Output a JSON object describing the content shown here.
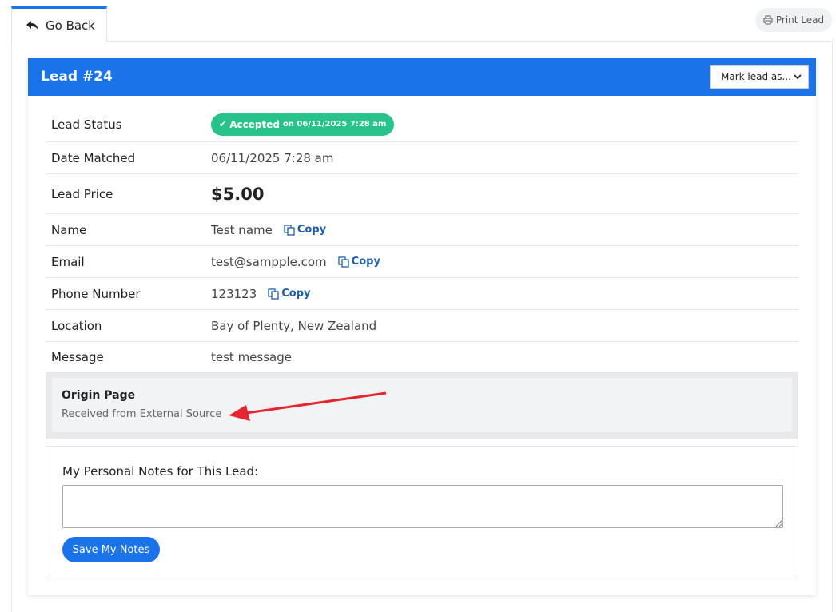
{
  "nav": {
    "go_back_label": "Go Back",
    "print_label": "Print Lead"
  },
  "card": {
    "title": "Lead #24",
    "mark_select_label": "Mark lead as..."
  },
  "details": {
    "status": {
      "label": "Lead Status",
      "badge_text": "Accepted",
      "badge_date": "on 06/11/2025 7:28 am"
    },
    "date_matched": {
      "label": "Date Matched",
      "value": "06/11/2025 7:28 am"
    },
    "price": {
      "label": "Lead Price",
      "value": "$5.00"
    },
    "name": {
      "label": "Name",
      "value": "Test name",
      "copy_label": "Copy"
    },
    "email": {
      "label": "Email",
      "value": "test@sampple.com",
      "copy_label": "Copy"
    },
    "phone": {
      "label": "Phone Number",
      "value": "123123",
      "copy_label": "Copy"
    },
    "location": {
      "label": "Location",
      "value": "Bay of Plenty, New Zealand"
    },
    "message": {
      "label": "Message",
      "value": "test message"
    }
  },
  "origin": {
    "title": "Origin Page",
    "text": "Received from External Source"
  },
  "notes": {
    "label": "My Personal Notes for This Lead:",
    "value": "",
    "save_label": "Save My Notes"
  },
  "colors": {
    "header_blue": "#1a73e8",
    "status_green": "#28c28b",
    "copy_link": "#1f5ea8",
    "arrow_red": "#e3262f"
  },
  "icons": {
    "go_back": "reply-arrow-icon",
    "print": "printer-icon",
    "select": "chevron-down-icon",
    "status": "check-icon",
    "copy": "copy-icon"
  }
}
